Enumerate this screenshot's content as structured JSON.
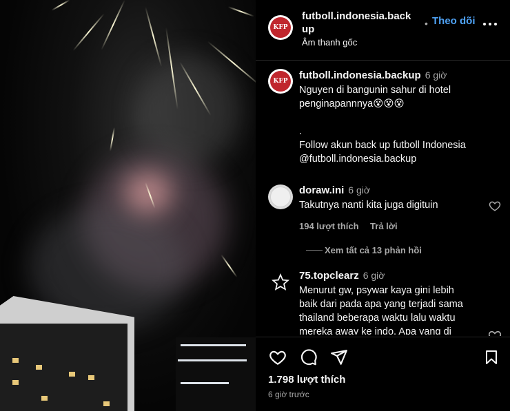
{
  "header": {
    "username": "futboll.indonesia.back up",
    "separator": "•",
    "follow_label": "Theo dõi",
    "audio": "Âm thanh gốc",
    "avatar_text": "KFP"
  },
  "caption": {
    "username": "futboll.indonesia.backup",
    "time": "6 giờ",
    "line1": "Nguyen di bangunin sahur di hotel",
    "line2": "penginapannnya😵😵😵",
    "line3": ".",
    "line4": "Follow akun back up futboll Indonesia",
    "line5": "@futboll.indonesia.backup"
  },
  "comments": [
    {
      "username": "doraw.ini",
      "time": "6 giờ",
      "text": "Takutnya nanti kita juga digituin",
      "likes": "194 lượt thích",
      "reply_label": "Trả lời",
      "view_replies": "Xem tất cả 13 phản hồi"
    },
    {
      "username": "75.topclearz",
      "time": "6 giờ",
      "line1": "Menurut gw, psywar kaya gini lebih",
      "line2": "baik dari pada apa yang terjadi sama",
      "line3": "thailand beberapa waktu lalu waktu",
      "line4": "mereka away ke indo. Apa yang di"
    }
  ],
  "footer": {
    "likes": "1.798 lượt thích",
    "time_ago": "6 giờ trước"
  },
  "colors": {
    "background": "#000000",
    "accent": "#4fa3f7",
    "muted": "#a8a8a8",
    "brand_red": "#c0262d"
  },
  "icons": [
    "heart-icon",
    "comment-icon",
    "share-icon",
    "bookmark-icon",
    "more-icon",
    "star-icon"
  ]
}
